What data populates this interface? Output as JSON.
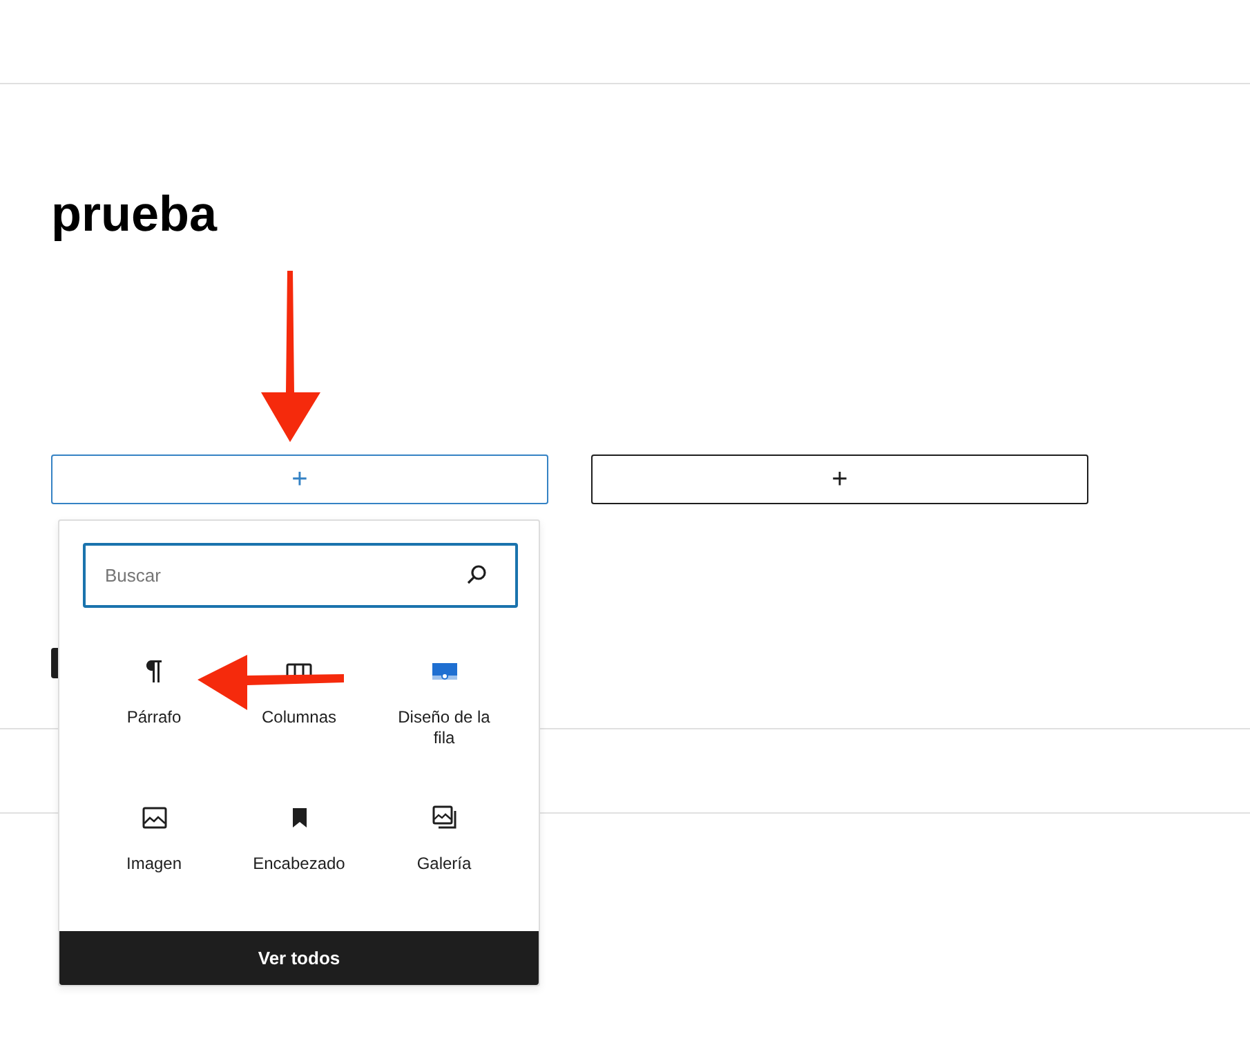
{
  "title": "prueba",
  "appenders": [
    {
      "label": "+",
      "selected": true
    },
    {
      "label": "+",
      "selected": false
    }
  ],
  "inserter": {
    "search": {
      "placeholder": "Buscar"
    },
    "blocks": [
      {
        "kind": "paragraph",
        "label": "Párrafo"
      },
      {
        "kind": "columns",
        "label": "Columnas"
      },
      {
        "kind": "row",
        "label": "Diseño de la fila"
      },
      {
        "kind": "image",
        "label": "Imagen"
      },
      {
        "kind": "heading",
        "label": "Encabezado"
      },
      {
        "kind": "gallery",
        "label": "Galería"
      }
    ],
    "browse_all": "Ver todos"
  }
}
